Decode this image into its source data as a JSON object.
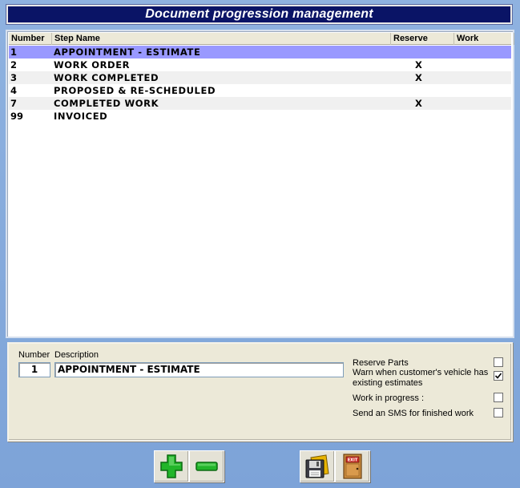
{
  "window": {
    "title": "Document progression management"
  },
  "list": {
    "columns": {
      "number": "Number",
      "step_name": "Step Name",
      "reserve": "Reserve",
      "work": "Work"
    },
    "rows": [
      {
        "number": "1",
        "name": "APPOINTMENT - ESTIMATE",
        "reserve": "",
        "work": "",
        "selected": true
      },
      {
        "number": "2",
        "name": "WORK ORDER",
        "reserve": "X",
        "work": "",
        "selected": false
      },
      {
        "number": "3",
        "name": "WORK COMPLETED",
        "reserve": "X",
        "work": "",
        "selected": false
      },
      {
        "number": "4",
        "name": "PROPOSED & RE-SCHEDULED",
        "reserve": "",
        "work": "",
        "selected": false
      },
      {
        "number": "7",
        "name": "COMPLETED WORK",
        "reserve": "X",
        "work": "",
        "selected": false
      },
      {
        "number": "99",
        "name": "INVOICED",
        "reserve": "",
        "work": "",
        "selected": false
      }
    ]
  },
  "detail": {
    "number_label": "Number",
    "description_label": "Description",
    "number_value": "1",
    "description_value": "APPOINTMENT - ESTIMATE",
    "options": {
      "reserve_parts": {
        "label": "Reserve Parts",
        "checked": false
      },
      "warn_estimates": {
        "label": "Warn when customer's vehicle has existing estimates",
        "checked": true
      },
      "work_in_progress": {
        "label": "Work in progress :",
        "checked": false
      },
      "send_sms": {
        "label": "Send an SMS for finished work",
        "checked": false
      }
    }
  },
  "toolbar": {
    "add_icon": "plus-icon",
    "remove_icon": "minus-icon",
    "save_icon": "floppy-disk-icon",
    "exit_icon": "exit-door-icon",
    "exit_sign_text": "EXIT"
  },
  "colors": {
    "title_bg": "#0a1466",
    "selected_row": "#9999ff",
    "panel_bg": "#ece9d8",
    "plus_green": "#22b52a",
    "minus_green": "#22b52a"
  }
}
